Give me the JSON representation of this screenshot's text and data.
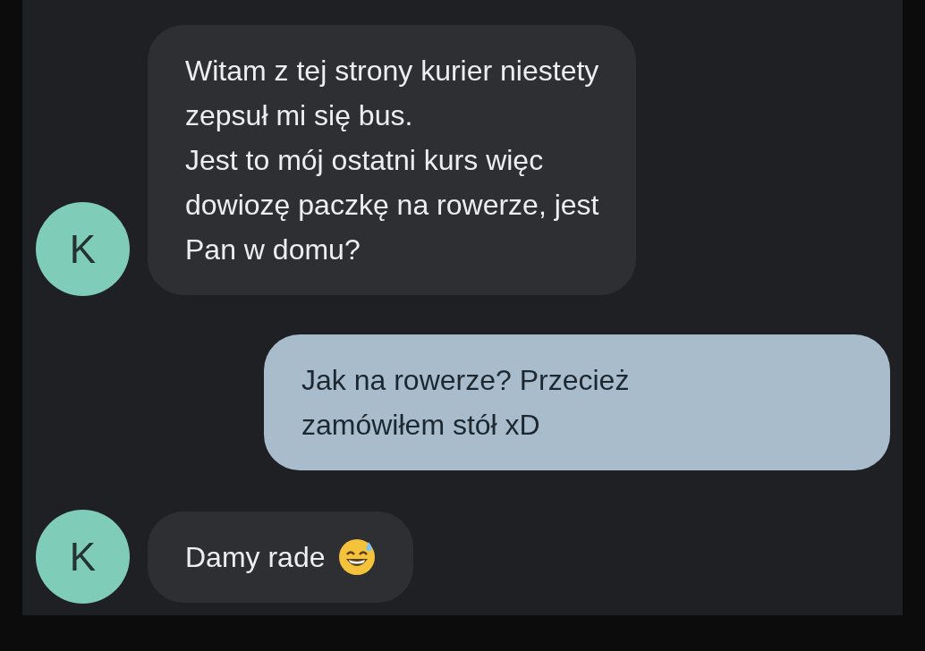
{
  "messages": [
    {
      "kind": "incoming",
      "avatar": "K",
      "text": "Witam z tej strony kurier niestety\nzepsuł mi się bus.\nJest to mój ostatni kurs więc\ndowiozę paczkę na rowerze, jest\nPan w domu?",
      "emoji": false
    },
    {
      "kind": "outgoing",
      "text": "Jak na rowerze? Przecież\nzamówiłem stół xD",
      "emoji": false
    },
    {
      "kind": "incoming",
      "avatar": "K",
      "text": "Damy rade",
      "emoji": true
    }
  ]
}
